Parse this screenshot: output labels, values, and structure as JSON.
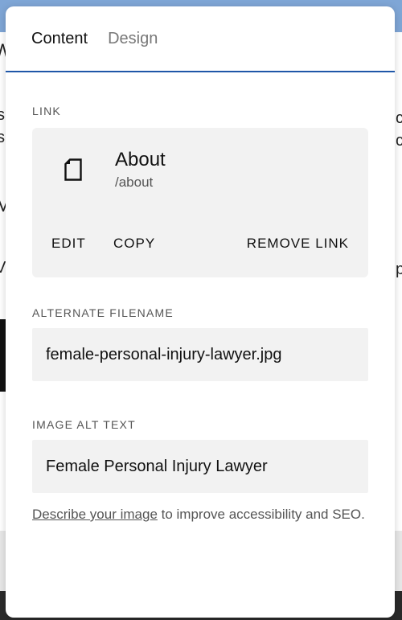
{
  "tabs": [
    {
      "label": "Content",
      "active": true
    },
    {
      "label": "Design",
      "active": false
    }
  ],
  "link_section": {
    "label": "LINK",
    "title": "About",
    "path": "/about",
    "icon": "page-icon",
    "actions": {
      "edit": "EDIT",
      "copy": "COPY",
      "remove": "REMOVE LINK"
    }
  },
  "filename_section": {
    "label": "ALTERNATE FILENAME",
    "value": "female-personal-injury-lawyer.jpg"
  },
  "alt_section": {
    "label": "IMAGE ALT TEXT",
    "value": "Female Personal Injury Lawyer"
  },
  "helper": {
    "link_text": "Describe your image",
    "rest_text": " to improve accessibility and SEO."
  },
  "colors": {
    "accent": "#1f57a8",
    "field_bg": "#f2f2f2"
  }
}
